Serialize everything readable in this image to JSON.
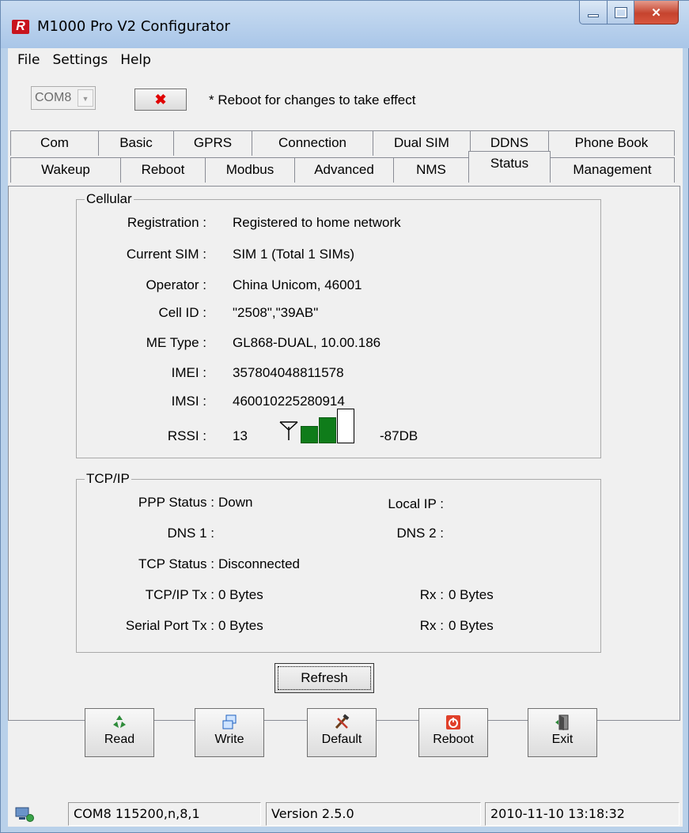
{
  "window": {
    "title": "M1000 Pro V2 Configurator",
    "app_icon": "R"
  },
  "menu": {
    "items": [
      "File",
      "Settings",
      "Help"
    ]
  },
  "toolbar": {
    "com_port": "COM8",
    "disconnect_glyph": "✖",
    "reboot_note": "* Reboot for changes to take effect"
  },
  "tabs": {
    "row1": [
      "Com",
      "Basic",
      "GPRS",
      "Connection",
      "Dual SIM",
      "DDNS",
      "Phone Book"
    ],
    "row2": [
      "Wakeup",
      "Reboot",
      "Modbus",
      "Advanced",
      "NMS",
      "Status",
      "Management"
    ],
    "active": "Status"
  },
  "cellular": {
    "title": "Cellular",
    "registration_label": "Registration :",
    "registration": "Registered to home network",
    "current_sim_label": "Current SIM :",
    "current_sim": "SIM 1  (Total 1 SIMs)",
    "operator_label": "Operator :",
    "operator": "China Unicom, 46001",
    "cell_id_label": "Cell ID :",
    "cell_id": "\"2508\",\"39AB\"",
    "me_type_label": "ME Type :",
    "me_type": "GL868-DUAL, 10.00.186",
    "imei_label": "IMEI :",
    "imei": "357804048811578",
    "imsi_label": "IMSI :",
    "imsi": "460010225280914",
    "rssi_label": "RSSI :",
    "rssi": "13",
    "rssi_db": "-87DB",
    "signal_bars_on": 2,
    "signal_bars_total": 3
  },
  "tcpip": {
    "title": "TCP/IP",
    "ppp_status_label": "PPP Status :",
    "ppp_status": "Down",
    "local_ip_label": "Local IP :",
    "local_ip": "",
    "dns1_label": "DNS 1 :",
    "dns1": "",
    "dns2_label": "DNS 2 :",
    "dns2": "",
    "tcp_status_label": "TCP Status :",
    "tcp_status": "Disconnected",
    "tcpip_tx_label": "TCP/IP Tx :",
    "tcpip_tx": "0 Bytes",
    "tcpip_rx_label": "Rx :",
    "tcpip_rx": "0 Bytes",
    "serial_tx_label": "Serial Port Tx :",
    "serial_tx": "0 Bytes",
    "serial_rx_label": "Rx :",
    "serial_rx": "0 Bytes"
  },
  "refresh_label": "Refresh",
  "actions": {
    "read": "Read",
    "write": "Write",
    "default": "Default",
    "reboot": "Reboot",
    "exit": "Exit"
  },
  "status_bar": {
    "port_settings": "COM8 115200,n,8,1",
    "version": "Version 2.5.0",
    "datetime": "2010-11-10 13:18:32"
  },
  "colors": {
    "signal_on": "#0f7c1a",
    "close_button": "#c5432e",
    "brand_red": "#c8141e"
  }
}
